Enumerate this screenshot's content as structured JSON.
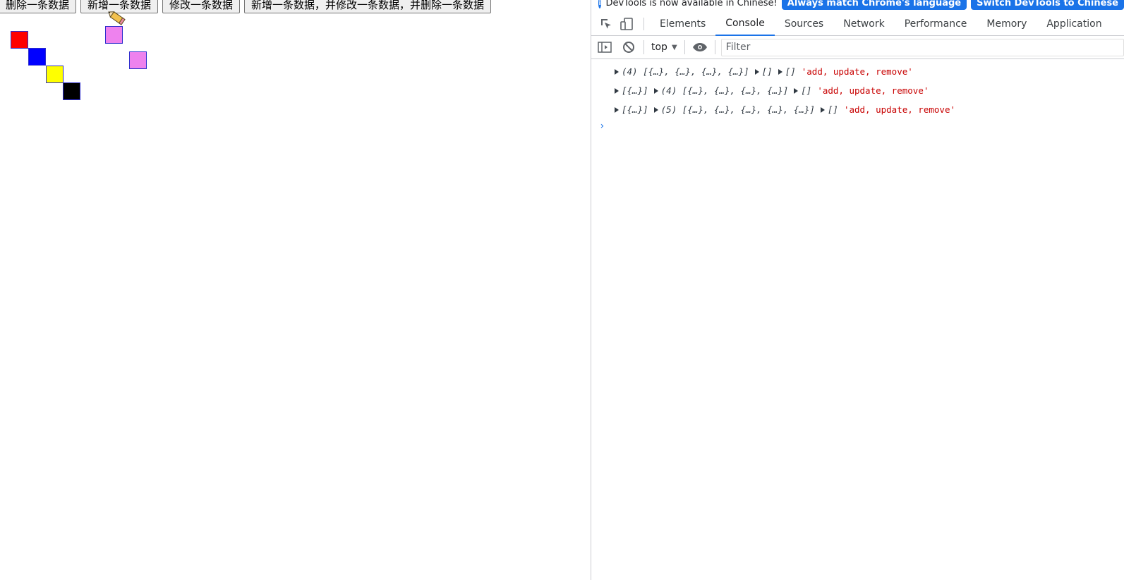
{
  "page": {
    "buttons": [
      "删除一条数据",
      "新增一条数据",
      "修改一条数据",
      "新增一条数据，并修改一条数据，并删除一条数据"
    ],
    "boxes": [
      {
        "color": "#ff0000"
      },
      {
        "color": "#0000ff"
      },
      {
        "color": "#ffff00"
      },
      {
        "color": "#000000"
      },
      {
        "color": "#ee82ee"
      },
      {
        "color": "#ee82ee"
      }
    ]
  },
  "devtools": {
    "infobar": {
      "message": "DevTools is now available in Chinese!",
      "button1": "Always match Chrome's language",
      "button2": "Switch DevTools to Chinese"
    },
    "tabs": [
      "Elements",
      "Console",
      "Sources",
      "Network",
      "Performance",
      "Memory",
      "Application"
    ],
    "active_tab": "Console",
    "toolbar": {
      "context": "top",
      "filter_placeholder": "Filter"
    },
    "console": {
      "lines": [
        {
          "a": "(4) [{…}, {…}, {…}, {…}]",
          "b": "[]",
          "c": "[]",
          "msg": "'add, update, remove'"
        },
        {
          "a": "[{…}]",
          "b": "(4) [{…}, {…}, {…}, {…}]",
          "c": "[]",
          "msg": "'add, update, remove'"
        },
        {
          "a": "[{…}]",
          "b": "(5) [{…}, {…}, {…}, {…}, {…}]",
          "c": "[]",
          "msg": "'add, update, remove'"
        }
      ],
      "prompt": "›"
    }
  }
}
